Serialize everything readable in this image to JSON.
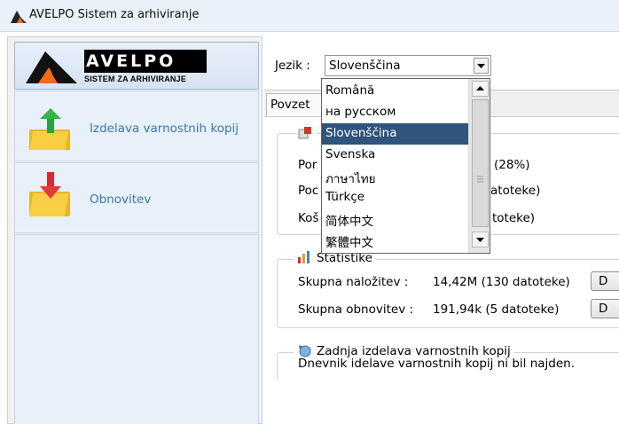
{
  "window": {
    "title": "AVELPO Sistem za arhiviranje"
  },
  "logo": {
    "word": "AVELPO",
    "subtitle": "SISTEM ZA ARHIVIRANJE"
  },
  "sidebar": {
    "items": [
      {
        "label": "Izdelava varnostnih kopij",
        "icon": "folder-upload-icon"
      },
      {
        "label": "Obnovitev",
        "icon": "folder-download-icon"
      }
    ]
  },
  "language": {
    "label": "Jezik :",
    "selected": "Slovenščina",
    "options": [
      "Română",
      "на русском",
      "Slovenščina",
      "Svenska",
      "ภาษาไทย",
      "Türkçe",
      "简体中文",
      "繁體中文"
    ],
    "selected_index": 2
  },
  "tabs": [
    {
      "label": "Povzet"
    }
  ],
  "overview": {
    "rows": [
      {
        "label": "Por",
        "value": "(28%)"
      },
      {
        "label": "Poc",
        "value": "atoteke)"
      },
      {
        "label": "Koš",
        "value": "toteke)"
      }
    ]
  },
  "statistics": {
    "title": "Statistike",
    "rows": [
      {
        "label": "Skupna naložitev :",
        "value": "14,42M  (130 datoteke)",
        "button": "D"
      },
      {
        "label": "Skupna obnovitev :",
        "value": "191,94k  (5 datoteke)",
        "button": "D"
      }
    ]
  },
  "last_backup": {
    "title": "Zadnja izdelava varnostnih kopij",
    "message": "Dnevnik idelave varnostnih kopij ni bil najden."
  },
  "colors": {
    "selection": "#30547b",
    "accent_link": "#3b77b0",
    "titlebar": "#eaf1fa"
  }
}
